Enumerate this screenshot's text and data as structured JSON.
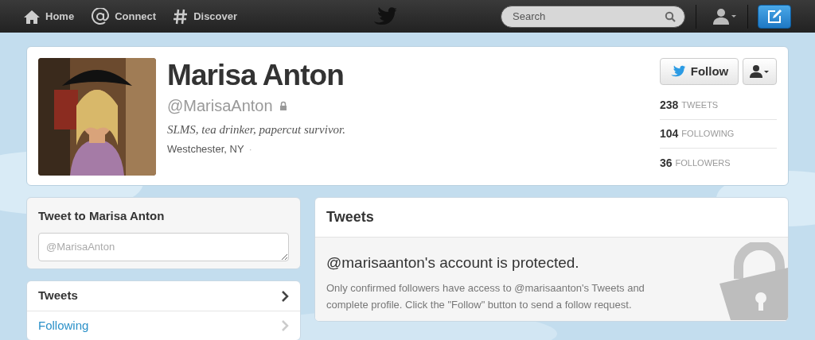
{
  "topbar": {
    "nav": [
      {
        "kind": "home",
        "label": "Home"
      },
      {
        "kind": "connect",
        "label": "Connect"
      },
      {
        "kind": "discover",
        "label": "Discover"
      }
    ],
    "search": {
      "placeholder": "Search"
    }
  },
  "profile": {
    "name": "Marisa Anton",
    "handle": "@MarisaAnton",
    "protected": true,
    "bio": "SLMS, tea drinker, papercut survivor.",
    "location": "Westchester, NY",
    "location_separator": "·",
    "follow_button": "Follow",
    "stats": [
      {
        "count": "238",
        "label": "TWEETS"
      },
      {
        "count": "104",
        "label": "FOLLOWING"
      },
      {
        "count": "36",
        "label": "FOLLOWERS"
      }
    ]
  },
  "tweet_to": {
    "title": "Tweet to Marisa Anton",
    "placeholder": "@MarisaAnton"
  },
  "sidebar": {
    "items": [
      {
        "label": "Tweets",
        "selected": true
      },
      {
        "label": "Following",
        "selected": false
      }
    ]
  },
  "tweets": {
    "title": "Tweets",
    "notice_title": "@marisaanton's account is protected.",
    "notice_body": "Only confirmed followers have access to @marisaanton's Tweets and complete profile. Click the \"Follow\" button to send a follow request."
  }
}
